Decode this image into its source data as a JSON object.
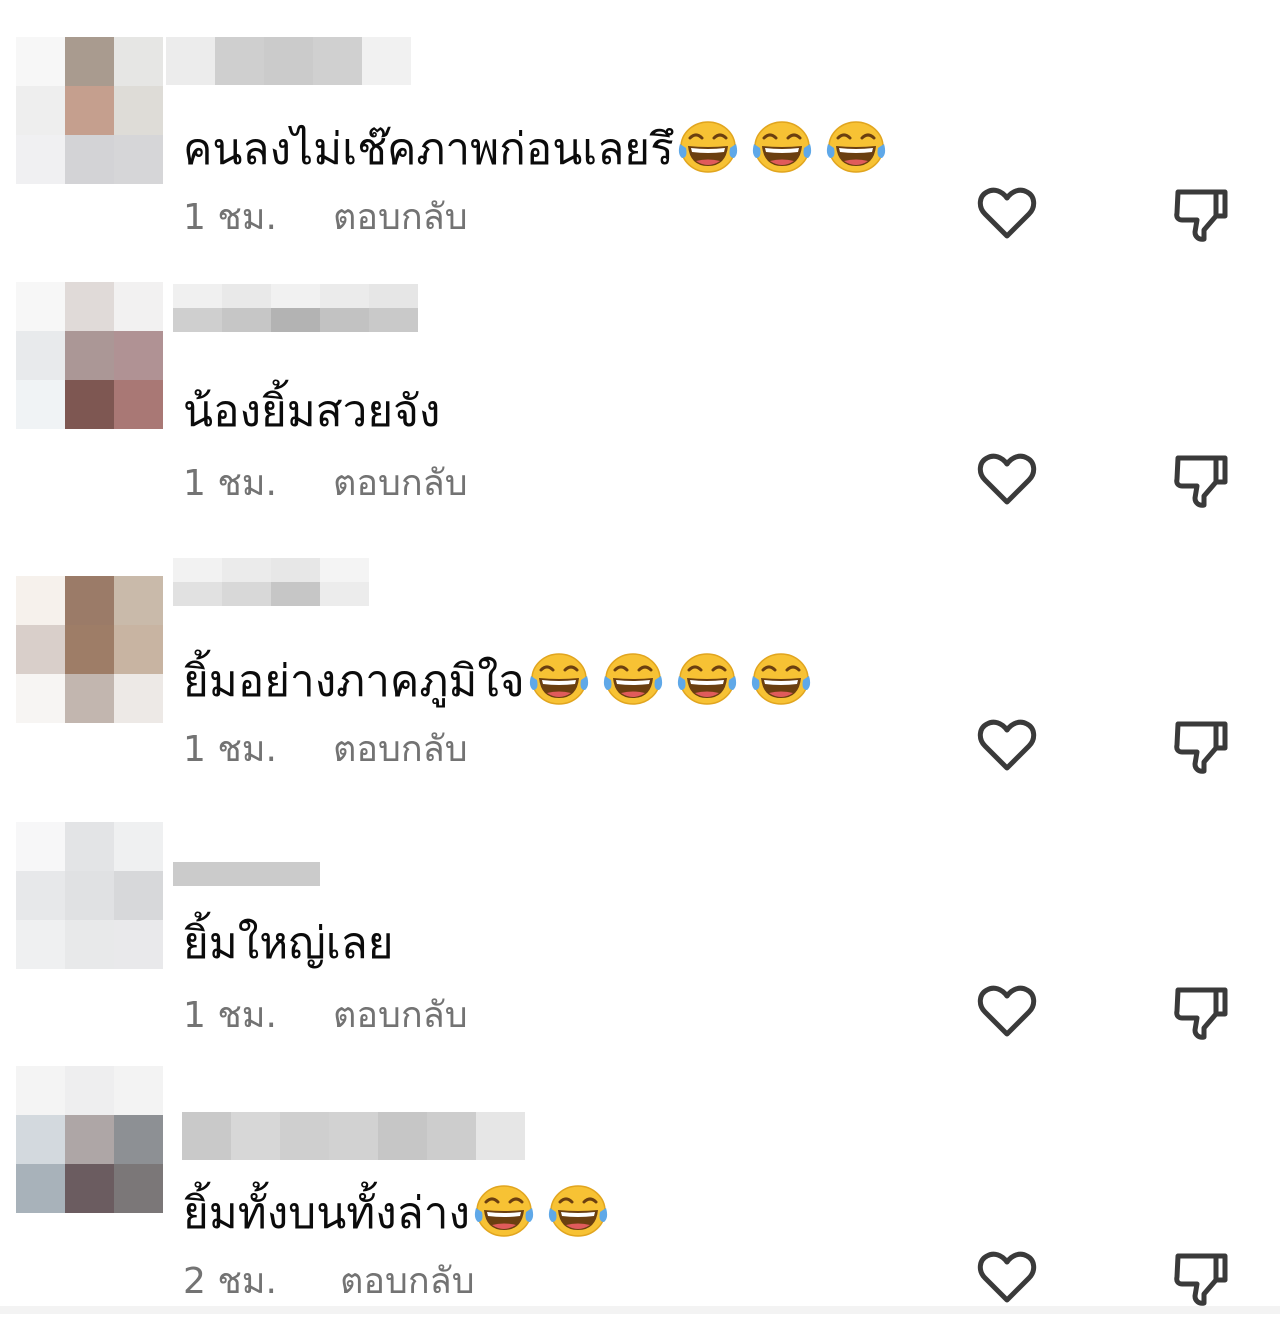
{
  "comments": [
    {
      "text": "คนลงไม่เช๊คภาพก่อนเลยรึ",
      "emoji_count": 3,
      "time": "1 ชม.",
      "reply_label": "ตอบกลับ",
      "avatar_colors": [
        "#f7f7f7",
        "#a99b8f",
        "#e6e6e4",
        "#eeeeee",
        "#c59f8e",
        "#dedcd7",
        "#f0f0f2",
        "#d3d3d6",
        "#d6d6d8"
      ]
    },
    {
      "text": "น้องยิ้มสวยจัง",
      "emoji_count": 0,
      "time": "1 ชม.",
      "reply_label": "ตอบกลับ",
      "avatar_colors": [
        "#f7f7f7",
        "#e0dad8",
        "#f2f1f1",
        "#e8eaec",
        "#ab9796",
        "#b09294",
        "#f0f3f5",
        "#7e5752",
        "#a97875"
      ]
    },
    {
      "text": "ยิ้มอย่างภาคภูมิใจ",
      "emoji_count": 4,
      "time": "1 ชม.",
      "reply_label": "ตอบกลับ",
      "avatar_colors": [
        "#f6f1ec",
        "#9b7b68",
        "#c9baaa",
        "#d9cfca",
        "#9e7d67",
        "#c8b4a2",
        "#f7f5f3",
        "#c2b6af",
        "#ede9e6"
      ]
    },
    {
      "text": "ยิ้มใหญ่เลย",
      "emoji_count": 0,
      "time": "1 ชม.",
      "reply_label": "ตอบกลับ",
      "avatar_colors": [
        "#f7f7f8",
        "#e3e4e6",
        "#eff0f1",
        "#e7e8ea",
        "#e0e1e3",
        "#d7d8da",
        "#eff0f1",
        "#e8e9ea",
        "#e9e9eb"
      ]
    },
    {
      "text": "ยิ้มทั้งบนทั้งล่าง",
      "emoji_count": 2,
      "time": "2 ชม.",
      "reply_label": "ตอบกลับ",
      "avatar_colors": [
        "#f4f4f4",
        "#eeeeef",
        "#f3f3f3",
        "#d3d9de",
        "#aea6a6",
        "#8d9094",
        "#a8b2ba",
        "#6b5c60",
        "#7b7778"
      ]
    }
  ],
  "icons": {
    "like": "heart-outline-icon",
    "dislike": "thumbs-down-outline-icon",
    "emoji": "face-with-tears-of-joy-emoji"
  },
  "colors": {
    "meta_text": "#737373",
    "icon_stroke": "#3a3a3a",
    "background": "#ffffff"
  }
}
